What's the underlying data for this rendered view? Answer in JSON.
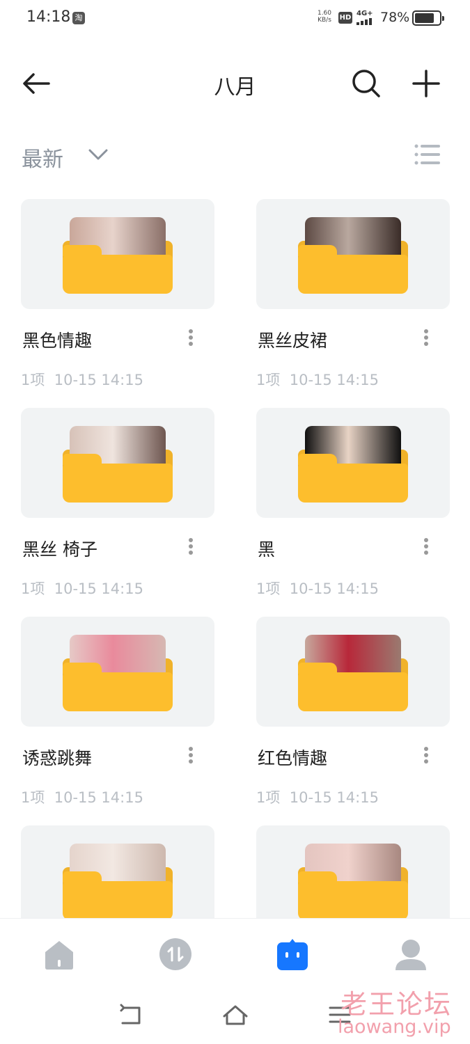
{
  "status_bar": {
    "time": "14:18",
    "app_badge": "淘",
    "speed_value": "1.60",
    "speed_unit": "KB/s",
    "hd": "HD",
    "network": "4G+",
    "battery": "78%",
    "battery_level": 0.78
  },
  "header": {
    "title": "八月",
    "back_icon": "arrow-left-icon",
    "search_icon": "search-icon",
    "add_icon": "plus-icon"
  },
  "sort": {
    "label": "最新",
    "chevron_icon": "chevron-down-icon",
    "view_icon": "list-view-icon"
  },
  "folders": [
    {
      "name": "黑色情趣",
      "count": "1项",
      "time": "10-15 14:15",
      "photo": [
        "#c9a79a",
        "#e7d3cb",
        "#8a6f68"
      ]
    },
    {
      "name": "黑丝皮裙",
      "count": "1项",
      "time": "10-15 14:15",
      "photo": [
        "#5d4a44",
        "#b9a89f",
        "#3a2c28"
      ]
    },
    {
      "name": "黑丝 椅子",
      "count": "1项",
      "time": "10-15 14:15",
      "photo": [
        "#d7c2b8",
        "#efe4de",
        "#6e5650"
      ]
    },
    {
      "name": "黑",
      "count": "1项",
      "time": "10-15 14:15",
      "photo": [
        "#101010",
        "#e8d3c5",
        "#101010"
      ]
    },
    {
      "name": "诱惑跳舞",
      "count": "1项",
      "time": "10-15 14:15",
      "photo": [
        "#e6c9c6",
        "#e98a9c",
        "#d6b8b2"
      ]
    },
    {
      "name": "红色情趣",
      "count": "1项",
      "time": "10-15 14:15",
      "photo": [
        "#c7a79c",
        "#b8283a",
        "#9a7a70"
      ]
    },
    {
      "name": "",
      "count": "",
      "time": "",
      "photo": [
        "#e5d4cc",
        "#f2e8e2",
        "#cdb8ae"
      ]
    },
    {
      "name": "",
      "count": "",
      "time": "",
      "photo": [
        "#e4c5c0",
        "#f0d2cc",
        "#a88880"
      ]
    }
  ],
  "bottom_nav": [
    {
      "name": "home-icon",
      "active": false
    },
    {
      "name": "transfer-icon",
      "active": false
    },
    {
      "name": "files-icon",
      "active": true
    },
    {
      "name": "profile-icon",
      "active": false
    }
  ],
  "system_nav": [
    "back-nav-icon",
    "home-nav-icon",
    "menu-nav-icon"
  ],
  "watermark": {
    "cn": "老王论坛",
    "en": "laowang.vip"
  },
  "colors": {
    "accent": "#1677ff",
    "folder": "#fdbe2d",
    "card_bg": "#f1f3f4",
    "muted_text": "#b9bec4",
    "sort_text": "#8a929c"
  }
}
